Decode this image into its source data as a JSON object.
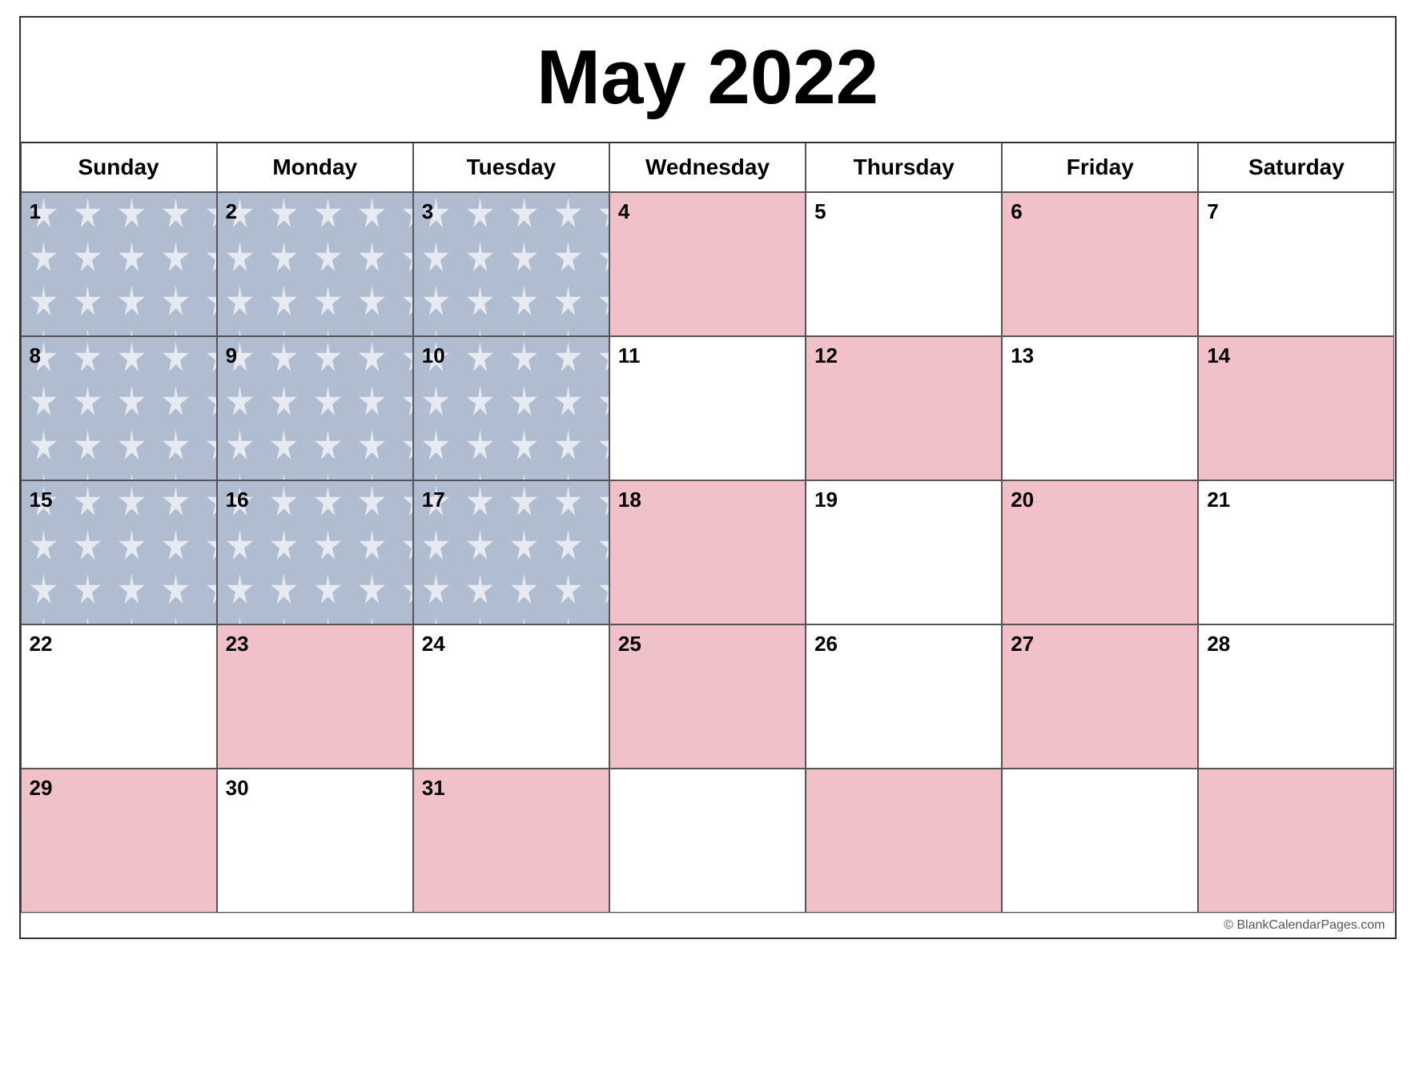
{
  "title": "May 2022",
  "watermark": "© BlankCalendarPages.com",
  "days_of_week": [
    "Sunday",
    "Monday",
    "Tuesday",
    "Wednesday",
    "Thursday",
    "Friday",
    "Saturday"
  ],
  "weeks": [
    {
      "days": [
        {
          "num": "1",
          "bg": "stars"
        },
        {
          "num": "2",
          "bg": "stars"
        },
        {
          "num": "3",
          "bg": "stars"
        },
        {
          "num": "4",
          "bg": "stripe_pink"
        },
        {
          "num": "5",
          "bg": "stripe_white"
        },
        {
          "num": "6",
          "bg": "stripe_pink"
        },
        {
          "num": "7",
          "bg": "stripe_white"
        }
      ]
    },
    {
      "days": [
        {
          "num": "8",
          "bg": "stars"
        },
        {
          "num": "9",
          "bg": "stars"
        },
        {
          "num": "10",
          "bg": "stars"
        },
        {
          "num": "11",
          "bg": "stripe_white"
        },
        {
          "num": "12",
          "bg": "stripe_pink"
        },
        {
          "num": "13",
          "bg": "stripe_white"
        },
        {
          "num": "14",
          "bg": "stripe_pink"
        }
      ]
    },
    {
      "days": [
        {
          "num": "15",
          "bg": "stars"
        },
        {
          "num": "16",
          "bg": "stars"
        },
        {
          "num": "17",
          "bg": "stars"
        },
        {
          "num": "18",
          "bg": "stripe_pink"
        },
        {
          "num": "19",
          "bg": "stripe_white"
        },
        {
          "num": "20",
          "bg": "stripe_pink"
        },
        {
          "num": "21",
          "bg": "stripe_white"
        }
      ]
    },
    {
      "days": [
        {
          "num": "22",
          "bg": "stripe_white"
        },
        {
          "num": "23",
          "bg": "stripe_pink"
        },
        {
          "num": "24",
          "bg": "stripe_white"
        },
        {
          "num": "25",
          "bg": "stripe_pink"
        },
        {
          "num": "26",
          "bg": "stripe_white"
        },
        {
          "num": "27",
          "bg": "stripe_pink"
        },
        {
          "num": "28",
          "bg": "stripe_white"
        }
      ]
    },
    {
      "days": [
        {
          "num": "29",
          "bg": "stripe_pink"
        },
        {
          "num": "30",
          "bg": "stripe_white"
        },
        {
          "num": "31",
          "bg": "stripe_pink"
        },
        {
          "num": "",
          "bg": "stripe_white"
        },
        {
          "num": "",
          "bg": "stripe_pink"
        },
        {
          "num": "",
          "bg": "stripe_white"
        },
        {
          "num": "",
          "bg": "stripe_pink"
        }
      ]
    }
  ],
  "colors": {
    "stars_bg": "#b0bdd0",
    "stripe_pink": "#f2c0c8",
    "stripe_white": "#ffffff",
    "border": "#555555",
    "text": "#000000"
  }
}
